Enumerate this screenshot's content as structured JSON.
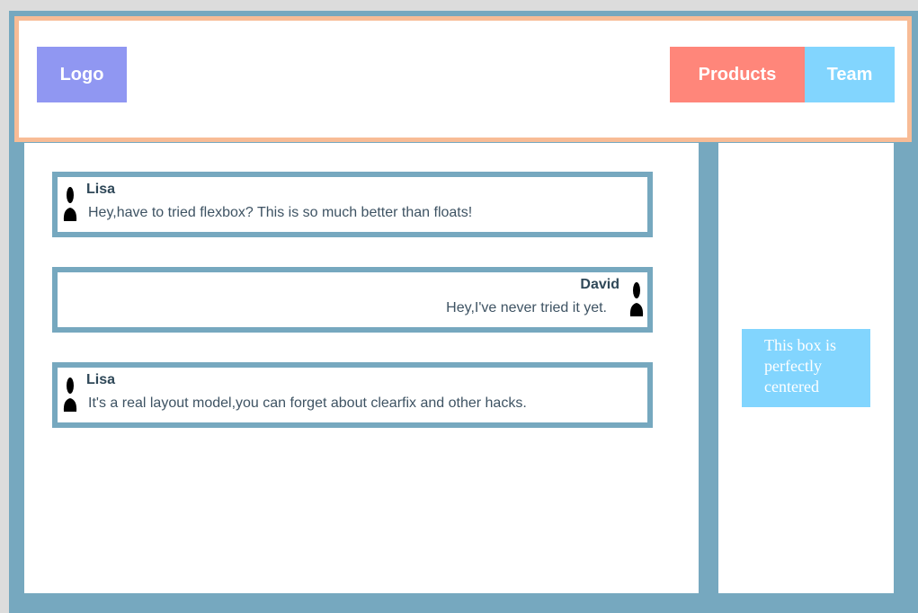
{
  "header": {
    "logo": "Logo",
    "nav": [
      {
        "label": "Products"
      },
      {
        "label": "Team"
      }
    ]
  },
  "messages": [
    {
      "name": "Lisa",
      "text": "Hey,have to tried flexbox? This is so much better than floats!",
      "align": "left"
    },
    {
      "name": "David",
      "text": "Hey,I've never tried it yet.",
      "align": "right"
    },
    {
      "name": "Lisa",
      "text": "It's a real layout model,you can forget about clearfix and other hacks.",
      "align": "left"
    }
  ],
  "sidebar": {
    "centered_box": "This box is perfectly centered"
  },
  "colors": {
    "frame": "#76a8bf",
    "header_border": "#f8bc96",
    "logo_bg": "#9097f2",
    "products_bg": "#ff867a",
    "team_bg": "#82d5fe",
    "centered_box_bg": "#82d5fe"
  },
  "icons": {
    "avatar": "person-silhouette-icon"
  }
}
